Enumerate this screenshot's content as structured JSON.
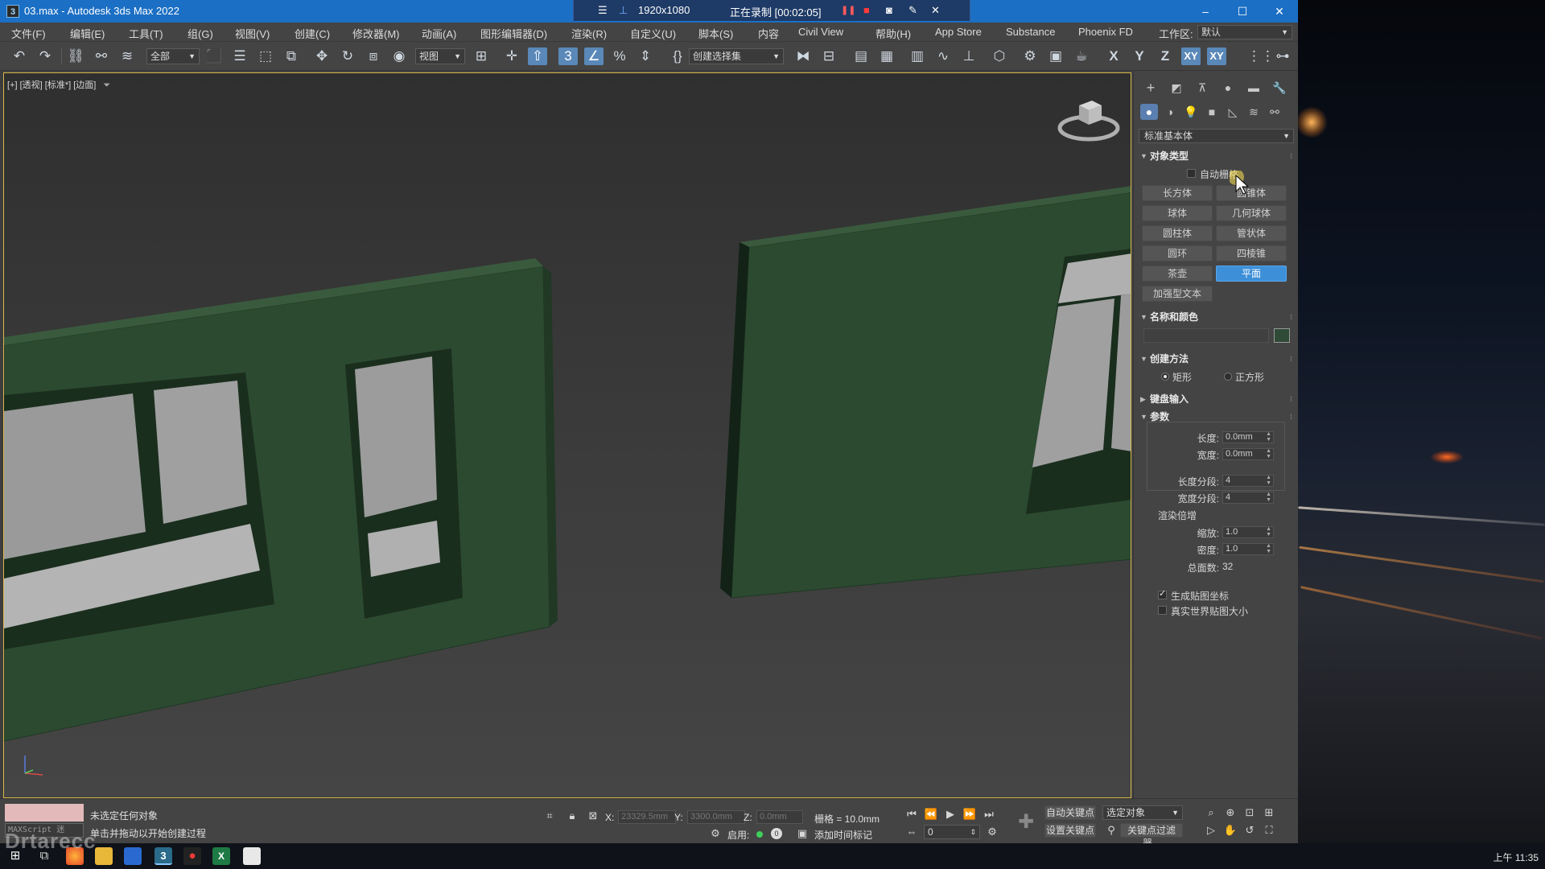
{
  "window": {
    "title": "03.max - Autodesk 3ds Max 2022",
    "app_icon": "3",
    "minimize": "–",
    "maximize": "☐",
    "close": "✕"
  },
  "recorder": {
    "menu_icon": "☰",
    "pin_icon": "📌",
    "resolution": "1920x1080",
    "status": "正在录制 [00:02:05]",
    "pause_icon": "❚❚",
    "stop_icon": "■",
    "camera_icon": "📷",
    "pen_icon": "✎",
    "close_icon": "✕"
  },
  "menu": {
    "items": [
      "文件(F)",
      "编辑(E)",
      "工具(T)",
      "组(G)",
      "视图(V)",
      "创建(C)",
      "修改器(M)",
      "动画(A)",
      "图形编辑器(D)",
      "渲染(R)",
      "自定义(U)",
      "脚本(S)",
      "内容",
      "Civil View",
      "帮助(H)",
      "App Store",
      "Substance",
      "Phoenix FD"
    ],
    "workspace_label": "工作区:",
    "workspace_value": "默认"
  },
  "toolbar": {
    "filter_select": "全部",
    "view_select": "视图",
    "selection_set": "创建选择集",
    "axis_x": "X",
    "axis_y": "Y",
    "axis_z": "Z",
    "axis_xy": "XY",
    "axis_xy2": "XY"
  },
  "viewport": {
    "label": "[+] [透视] [标准*] [边面]",
    "filter_icon": "⚲"
  },
  "command_panel": {
    "category": "标准基本体",
    "object_type": {
      "header": "对象类型",
      "autogrid_label": "自动栅格",
      "autogrid_checked": false,
      "buttons": [
        "长方体",
        "圆锥体",
        "球体",
        "几何球体",
        "圆柱体",
        "管状体",
        "圆环",
        "四棱锥",
        "茶壶",
        "平面",
        "加强型文本"
      ],
      "active_button": "平面"
    },
    "name_color": {
      "header": "名称和颜色",
      "name_value": "",
      "color": "#2f4a36"
    },
    "creation_method": {
      "header": "创建方法",
      "option_rect": "矩形",
      "option_square": "正方形",
      "selected": "矩形"
    },
    "keyboard_entry": {
      "header": "键盘输入"
    },
    "parameters": {
      "header": "参数",
      "length_label": "长度:",
      "length_value": "0.0mm",
      "width_label": "宽度:",
      "width_value": "0.0mm",
      "length_segs_label": "长度分段:",
      "length_segs_value": "4",
      "width_segs_label": "宽度分段:",
      "width_segs_value": "4",
      "render_group_label": "渲染倍增",
      "scale_label": "缩放:",
      "scale_value": "1.0",
      "density_label": "密度:",
      "density_value": "1.0",
      "total_faces_label": "总面数:",
      "total_faces_value": "32",
      "gen_mapping_label": "生成贴图坐标",
      "gen_mapping_checked": true,
      "real_world_label": "真实世界贴图大小",
      "real_world_checked": false
    }
  },
  "status_bar": {
    "maxscript_label": "MAXScript 迷",
    "selection_status": "未选定任何对象",
    "prompt": "单击并拖动以开始创建过程",
    "x_label": "X:",
    "x_value": "23329.5mm",
    "y_label": "Y:",
    "y_value": "3300.0mm",
    "z_label": "Z:",
    "z_value": "0.0mm",
    "grid": "栅格 = 10.0mm",
    "enable_label": "启用:",
    "add_time_tag": "添加时间标记",
    "frame_value": "0",
    "auto_key": "自动关键点",
    "set_key": "设置关键点",
    "selected_object": "选定对象",
    "key_filters": "关键点过滤器..."
  },
  "taskbar": {
    "clock": "上午 11:35"
  },
  "watermark": "Drtarecc"
}
